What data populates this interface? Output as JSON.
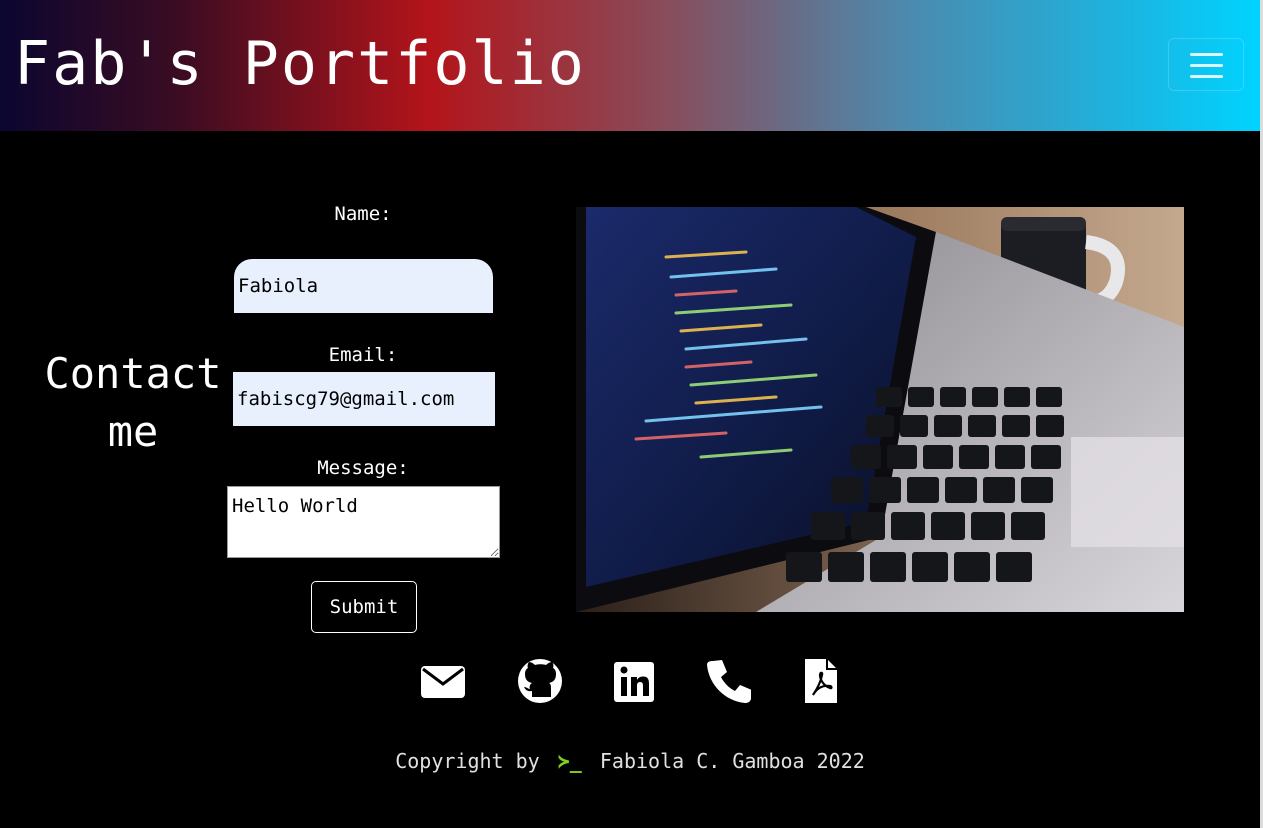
{
  "header": {
    "brand": "Fab's Portfolio",
    "menu_icon": "hamburger-menu-icon"
  },
  "contact": {
    "heading_line1": "Contact",
    "heading_line2": "me",
    "name_label": "Name:",
    "name_value": "Fabiola",
    "email_label": "Email:",
    "email_value": "fabiscg79@gmail.com",
    "message_label": "Message:",
    "message_value": "Hello World",
    "submit_label": "Submit"
  },
  "social_icons": [
    "envelope-icon",
    "github-icon",
    "linkedin-icon",
    "phone-icon",
    "pdf-file-icon"
  ],
  "footer": {
    "prefix": "Copyright by",
    "prompt_symbol": "≻_",
    "suffix": "Fabiola C. Gamboa 2022"
  },
  "colors": {
    "background": "#000000",
    "footer_prompt": "#7ed321",
    "input_fill": "#e8f0fe"
  }
}
